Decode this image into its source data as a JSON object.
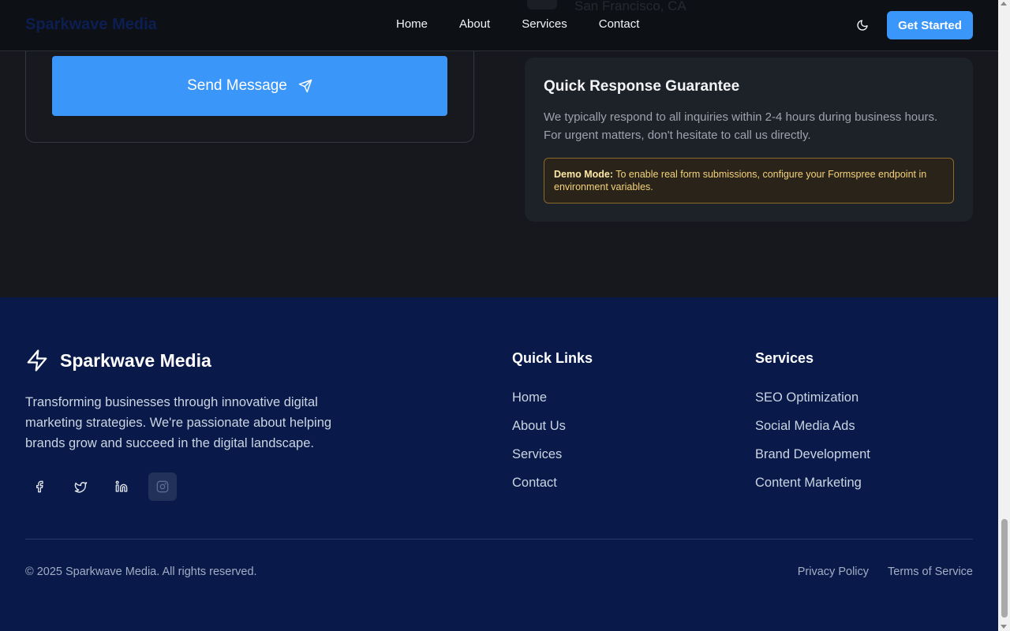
{
  "header": {
    "brand": "Sparkwave Media",
    "nav": [
      "Home",
      "About",
      "Services",
      "Contact"
    ],
    "theme_toggle_icon": "moon-icon",
    "cta": "Get Started"
  },
  "ghost": {
    "location": "San Francisco, CA"
  },
  "contact_form": {
    "send_label": "Send Message",
    "send_icon": "send-icon"
  },
  "quick_response": {
    "title": "Quick Response Guarantee",
    "text": "We typically respond to all inquiries within 2-4 hours during business hours. For urgent matters, don't hesitate to call us directly.",
    "demo_label": "Demo Mode:",
    "demo_text": " To enable real form submissions, configure your Formspree endpoint in environment variables."
  },
  "footer": {
    "brand": "Sparkwave Media",
    "description": "Transforming businesses through innovative digital marketing strategies. We're passionate about helping brands grow and succeed in the digital landscape.",
    "socials": [
      "facebook-icon",
      "twitter-icon",
      "linkedin-icon",
      "instagram-icon"
    ],
    "quick_links": {
      "title": "Quick Links",
      "items": [
        "Home",
        "About Us",
        "Services",
        "Contact"
      ]
    },
    "services": {
      "title": "Services",
      "items": [
        "SEO Optimization",
        "Social Media Ads",
        "Brand Development",
        "Content Marketing"
      ]
    },
    "copyright": "© 2025 Sparkwave Media. All rights reserved.",
    "legal": [
      "Privacy Policy",
      "Terms of Service"
    ]
  },
  "colors": {
    "accent": "#3b96fa",
    "page_bg": "#16181d",
    "footer_bg": "#08194a",
    "demo_text": "#f4d27a"
  }
}
